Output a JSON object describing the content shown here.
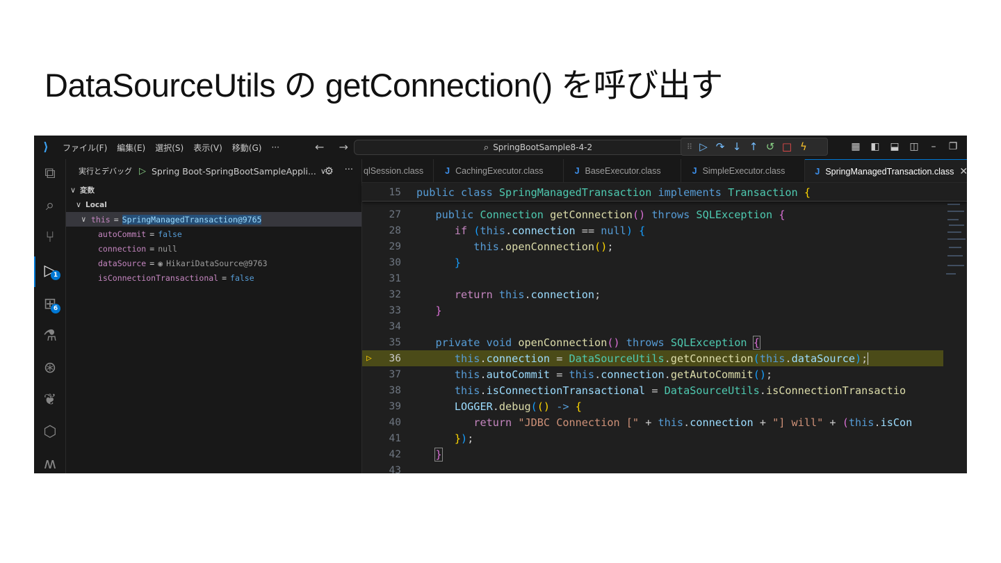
{
  "slide_title": "DataSourceUtils の getConnection() を呼び出す",
  "titlebar": {
    "menu": [
      "ファイル(F)",
      "編集(E)",
      "選択(S)",
      "表示(V)",
      "移動(G)",
      "···"
    ],
    "search_text": "SpringBootSample8-4-2",
    "nav": "← →"
  },
  "activity_badges": {
    "debug": "1",
    "extensions": "6"
  },
  "sidebar": {
    "run_label": "実行とデバッグ",
    "config": "Spring Boot-SpringBootSampleAppli...",
    "section_vars": "変数",
    "section_local": "Local",
    "this_name": "this",
    "this_value": "SpringManagedTransaction@9765",
    "vars": [
      {
        "name": "autoCommit",
        "value": "false",
        "kind": "bool"
      },
      {
        "name": "connection",
        "value": "null",
        "kind": "null"
      },
      {
        "name": "dataSource",
        "value": "HikariDataSource@9763",
        "kind": "obj"
      },
      {
        "name": "isConnectionTransactional",
        "value": "false",
        "kind": "bool"
      }
    ]
  },
  "tabs": [
    {
      "label": "qlSession.class",
      "icon": false
    },
    {
      "label": "CachingExecutor.class",
      "icon": true
    },
    {
      "label": "BaseExecutor.class",
      "icon": true
    },
    {
      "label": "SimpleExecutor.class",
      "icon": true
    },
    {
      "label": "SpringManagedTransaction.class",
      "icon": true,
      "active": true
    }
  ],
  "tab_icon": "J",
  "line_numbers": {
    "sticky": "15",
    "lines": [
      "27",
      "28",
      "29",
      "30",
      "31",
      "32",
      "33",
      "34",
      "35",
      "36",
      "37",
      "38",
      "39",
      "40",
      "41",
      "42",
      "43"
    ]
  }
}
